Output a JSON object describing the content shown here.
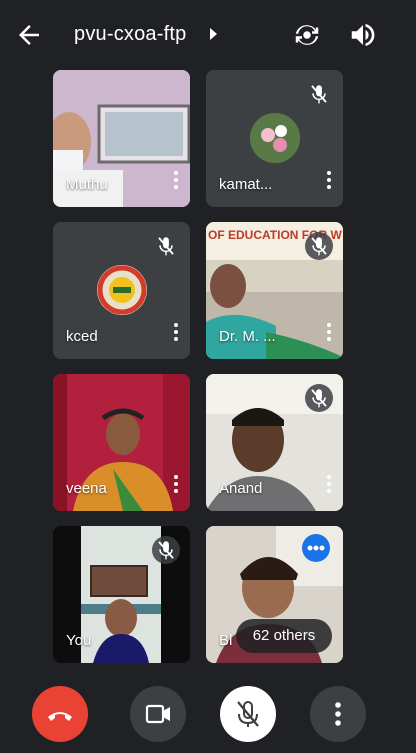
{
  "header": {
    "back_icon": "arrow-left-icon",
    "meeting_code": "pvu-cxoa-ftp",
    "expand_icon": "caret-right-icon",
    "flip_camera_icon": "flip-camera-icon",
    "speaker_icon": "volume-icon"
  },
  "tiles": [
    {
      "name": "Muthu",
      "muted": false
    },
    {
      "name": "kamat...",
      "muted": true
    },
    {
      "name": "kced",
      "muted": true
    },
    {
      "name": "Dr. M. ...",
      "muted": true,
      "banner_text": "OF EDUCATION FOR W"
    },
    {
      "name": "veena",
      "muted": false
    },
    {
      "name": "Anand",
      "muted": true
    },
    {
      "name": "You",
      "muted": true
    },
    {
      "name": "Bl",
      "muted": false
    }
  ],
  "overflow": {
    "others_label": "62 others"
  },
  "controls": {
    "end_call_icon": "phone-hangup-icon",
    "camera_icon": "video-camera-icon",
    "mic_icon": "mic-off-icon",
    "more_icon": "more-vert-icon"
  },
  "colors": {
    "background": "#202124",
    "tile": "#3c4043",
    "end_call": "#ea4335",
    "accent_blue": "#1a73e8"
  }
}
